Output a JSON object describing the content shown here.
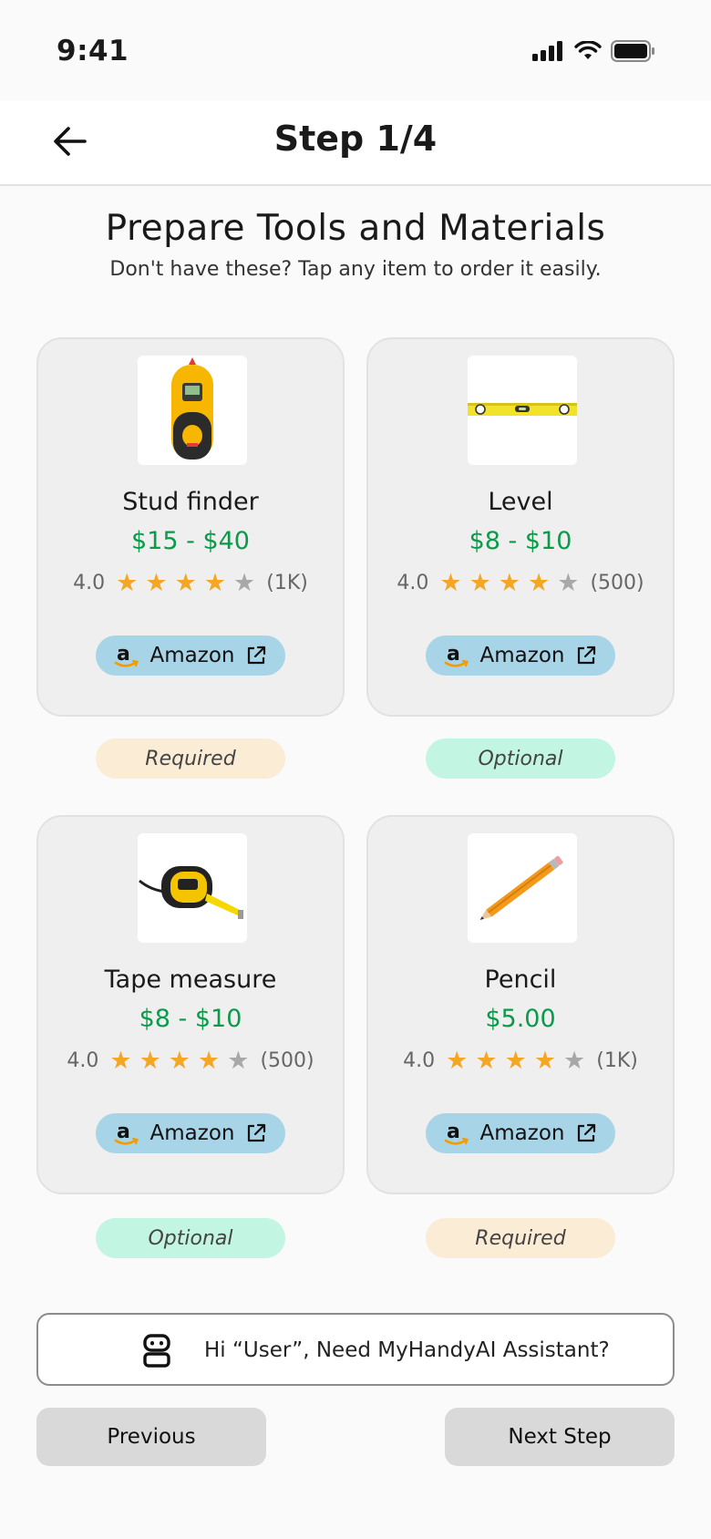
{
  "status": {
    "time": "9:41"
  },
  "header": {
    "title": "Step 1/4"
  },
  "intro": {
    "title": "Prepare Tools and Materials",
    "subtitle": "Don't have these? Tap any item to order it easily."
  },
  "items": [
    {
      "name": "Stud finder",
      "price": "$15 - $40",
      "rating": "4.0",
      "stars": 4,
      "count": "(1K)",
      "store": "Amazon",
      "tag": "Required",
      "tag_type": "required"
    },
    {
      "name": "Level",
      "price": "$8 - $10",
      "rating": "4.0",
      "stars": 4,
      "count": "(500)",
      "store": "Amazon",
      "tag": "Optional",
      "tag_type": "optional"
    },
    {
      "name": "Tape measure",
      "price": "$8 - $10",
      "rating": "4.0",
      "stars": 4,
      "count": "(500)",
      "store": "Amazon",
      "tag": "Optional",
      "tag_type": "optional"
    },
    {
      "name": "Pencil",
      "price": "$5.00",
      "rating": "4.0",
      "stars": 4,
      "count": "(1K)",
      "store": "Amazon",
      "tag": "Required",
      "tag_type": "required"
    }
  ],
  "assistant": {
    "text": "Hi “User”, Need MyHandyAI Assistant?"
  },
  "footer": {
    "previous_label": "Previous",
    "next_label": "Next Step"
  },
  "colors": {
    "price": "#0a9a4a",
    "star_on": "#f5a623",
    "amazon_btn": "#a8d4e8",
    "required_tag": "#fbecd6",
    "optional_tag": "#c2f5e2"
  }
}
